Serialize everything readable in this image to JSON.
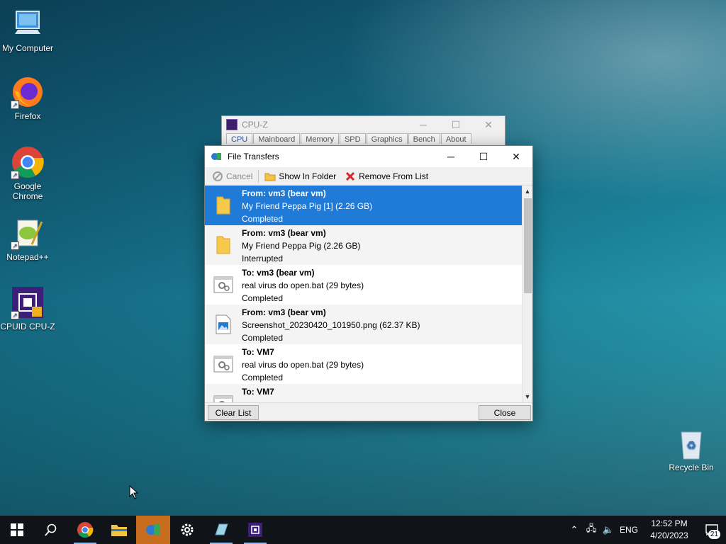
{
  "desktop": {
    "icons": [
      {
        "label": "My Computer",
        "icon": "computer-icon"
      },
      {
        "label": "Firefox",
        "icon": "firefox-icon"
      },
      {
        "label": "Google Chrome",
        "icon": "chrome-icon"
      },
      {
        "label": "Notepad++",
        "icon": "notepadpp-icon"
      },
      {
        "label": "CPUID CPU-Z",
        "icon": "cpuz-icon"
      },
      {
        "label": "Recycle Bin",
        "icon": "recycle-bin-icon"
      }
    ]
  },
  "cpuz_window": {
    "title": "CPU-Z",
    "tabs": [
      "CPU",
      "Mainboard",
      "Memory",
      "SPD",
      "Graphics",
      "Bench",
      "About"
    ]
  },
  "file_transfers": {
    "title": "File Transfers",
    "toolbar": {
      "cancel": "Cancel",
      "show_in_folder": "Show In Folder",
      "remove_from_list": "Remove From List"
    },
    "items": [
      {
        "direction": "From: vm3 (bear vm)",
        "name": "My Friend Peppa Pig [1] (2.26 GB)",
        "status": "Completed",
        "icon": "folder-icon"
      },
      {
        "direction": "From: vm3 (bear vm)",
        "name": "My Friend Peppa Pig (2.26 GB)",
        "status": "Interrupted",
        "icon": "folder-icon"
      },
      {
        "direction": "To: vm3 (bear vm)",
        "name": "real virus do open.bat (29 bytes)",
        "status": "Completed",
        "icon": "batch-file-icon"
      },
      {
        "direction": "From: vm3 (bear vm)",
        "name": "Screenshot_20230420_101950.png (62.37 KB)",
        "status": "Completed",
        "icon": "image-file-icon"
      },
      {
        "direction": "To: VM7",
        "name": "real virus do open.bat (29 bytes)",
        "status": "Completed",
        "icon": "batch-file-icon"
      },
      {
        "direction": "To: VM7",
        "name": "",
        "status": "",
        "icon": "batch-file-icon"
      }
    ],
    "buttons": {
      "clear_list": "Clear List",
      "close": "Close"
    }
  },
  "taskbar": {
    "apps": [
      "start-icon",
      "search-icon",
      "chrome-icon",
      "file-explorer-icon",
      "file-transfers-icon",
      "settings-icon",
      "notepad-icon",
      "cpuz-icon"
    ],
    "language": "ENG",
    "time": "12:52 PM",
    "date": "4/20/2023",
    "notification_count": "21"
  },
  "colors": {
    "selection": "#1f7ad8",
    "taskbar_active": "#c86c1e"
  }
}
